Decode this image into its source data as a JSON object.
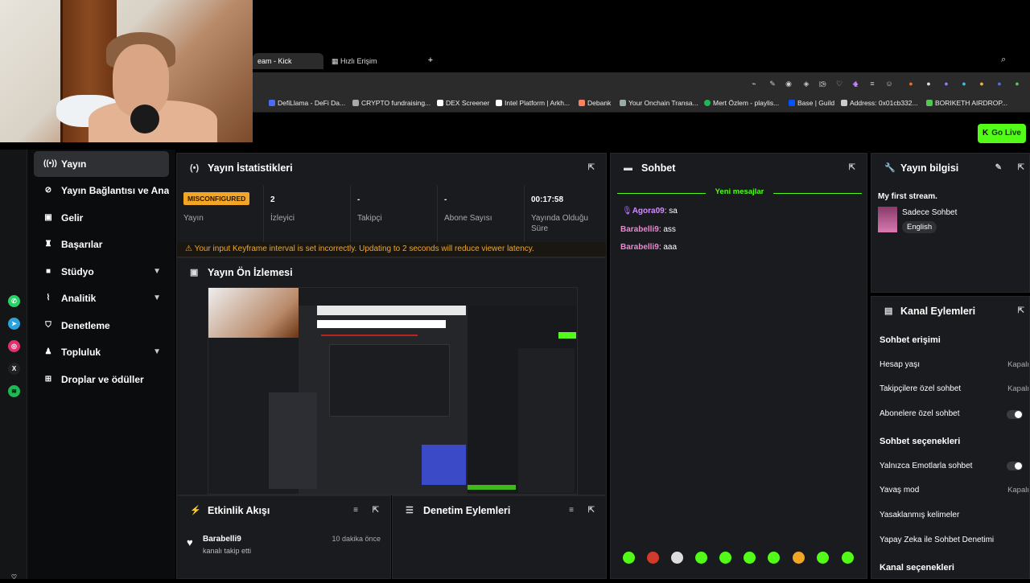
{
  "browser": {
    "tabs": [
      {
        "label": "eam - Kick Dashboard",
        "active": true
      },
      {
        "label": "Hızlı Erişim",
        "active": false
      }
    ],
    "new_tab": "+",
    "bookmarks": [
      {
        "label": "DefiLlama - DeFi Da...",
        "color": "#4a6cf7"
      },
      {
        "label": "CRYPTO fundraising...",
        "color": "#aaa"
      },
      {
        "label": "DEX Screener",
        "color": "#fff"
      },
      {
        "label": "Intel Platform | Arkh...",
        "color": "#fff"
      },
      {
        "label": "Debank",
        "color": "#fe815f"
      },
      {
        "label": "Your Onchain Transa...",
        "color": "#9aa"
      },
      {
        "label": "Mert Özlem - playlis...",
        "color": "#1db954"
      },
      {
        "label": "Base | Guild",
        "color": "#0052ff"
      },
      {
        "label": "Address: 0x01cb332...",
        "color": "#ccc"
      },
      {
        "label": "BORIKETH AIRDROP...",
        "color": "#53c653"
      }
    ]
  },
  "header": {
    "go_live": "Go Live",
    "accent": "#53fc18"
  },
  "sidebar": {
    "items": [
      {
        "label": "Yayın",
        "icon": "broadcast-icon",
        "active": true
      },
      {
        "label": "Yayın Bağlantısı ve Anahtarı",
        "icon": "link-icon"
      },
      {
        "label": "Gelir",
        "icon": "dollar-icon"
      },
      {
        "label": "Başarılar",
        "icon": "trophy-icon"
      },
      {
        "label": "Stüdyo",
        "icon": "studio-icon",
        "expandable": true
      },
      {
        "label": "Analitik",
        "icon": "analytics-icon",
        "expandable": true
      },
      {
        "label": "Denetleme",
        "icon": "shield-icon"
      },
      {
        "label": "Topluluk",
        "icon": "community-icon",
        "expandable": true
      },
      {
        "label": "Droplar ve ödüller",
        "icon": "gift-icon"
      }
    ]
  },
  "stats": {
    "title": "Yayın İstatistikleri",
    "badge": "MISCONFIGURED",
    "status_label": "Yayın",
    "viewers_value": "2",
    "viewers_label": "İzleyici",
    "followers_value": "-",
    "followers_label": "Takipçi",
    "subs_value": "-",
    "subs_label": "Abone Sayısı",
    "uptime_value": "00:17:58",
    "uptime_label": "Yayında Olduğu Süre",
    "warning": "Your input Keyframe interval is set incorrectly. Updating to 2 seconds will reduce viewer latency."
  },
  "preview": {
    "title": "Yayın Ön İzlemesi"
  },
  "chat": {
    "title": "Sohbet",
    "new_messages": "Yeni mesajlar",
    "messages": [
      {
        "user": "Agora09",
        "text": "sa",
        "user_color": "#d38cff"
      },
      {
        "user": "Barabelli9",
        "text": "ass",
        "user_color": "#e88ad1"
      },
      {
        "user": "Barabelli9",
        "text": "aaa",
        "user_color": "#e88ad1"
      }
    ]
  },
  "stream_info": {
    "title": "Yayın bilgisi",
    "stream_title": "My first stream.",
    "category": "Sadece Sohbet",
    "language": "English"
  },
  "channel_actions": {
    "title": "Kanal Eylemleri",
    "chat_access": "Sohbet erişimi",
    "account_age": "Hesap yaşı",
    "account_age_value": "Kapalı",
    "followers_only": "Takipçilere özel sohbet",
    "followers_only_value": "Kapalı",
    "subs_only": "Abonelere özel sohbet",
    "chat_options": "Sohbet seçenekleri",
    "emotes_only": "Yalnızca Emotlarla sohbet",
    "slow_mode": "Yavaş mod",
    "slow_mode_value": "Kapalı",
    "banned_words": "Yasaklanmış kelimeler",
    "ai_moderation": "Yapay Zeka ile Sohbet Denetimi",
    "channel_options": "Kanal seçenekleri"
  },
  "activity": {
    "title": "Etkinlik Akışı",
    "events": [
      {
        "user": "Barabelli9",
        "action": "kanalı takip etti",
        "time": "10 dakika önce"
      }
    ]
  },
  "mod_actions": {
    "title": "Denetim Eylemleri"
  }
}
